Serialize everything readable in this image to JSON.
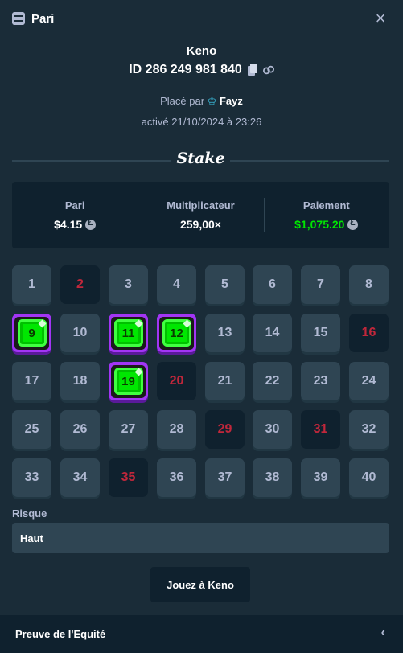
{
  "header": {
    "title": "Pari",
    "icon": "bet-slip-icon",
    "close_icon": "close-icon"
  },
  "bet": {
    "game": "Keno",
    "id": "ID 286 249 981 840",
    "placed_prefix": "Placé par",
    "user": "Fayz",
    "activated": "activé 21/10/2024 à 23:26"
  },
  "brand": "Stake",
  "summary": {
    "bet_label": "Pari",
    "bet_value": "$4.15",
    "multiplier_label": "Multiplicateur",
    "multiplier_value": "259,00×",
    "payout_label": "Paiement",
    "payout_value": "$1,075.20",
    "payout_color": "#00e701"
  },
  "grid": {
    "tiles": [
      {
        "n": "1",
        "s": "normal"
      },
      {
        "n": "2",
        "s": "miss"
      },
      {
        "n": "3",
        "s": "normal"
      },
      {
        "n": "4",
        "s": "normal"
      },
      {
        "n": "5",
        "s": "normal"
      },
      {
        "n": "6",
        "s": "normal"
      },
      {
        "n": "7",
        "s": "normal"
      },
      {
        "n": "8",
        "s": "normal"
      },
      {
        "n": "9",
        "s": "hit"
      },
      {
        "n": "10",
        "s": "normal"
      },
      {
        "n": "11",
        "s": "hit"
      },
      {
        "n": "12",
        "s": "hit"
      },
      {
        "n": "13",
        "s": "normal"
      },
      {
        "n": "14",
        "s": "normal"
      },
      {
        "n": "15",
        "s": "normal"
      },
      {
        "n": "16",
        "s": "miss"
      },
      {
        "n": "17",
        "s": "normal"
      },
      {
        "n": "18",
        "s": "normal"
      },
      {
        "n": "19",
        "s": "hit"
      },
      {
        "n": "20",
        "s": "miss"
      },
      {
        "n": "21",
        "s": "normal"
      },
      {
        "n": "22",
        "s": "normal"
      },
      {
        "n": "23",
        "s": "normal"
      },
      {
        "n": "24",
        "s": "normal"
      },
      {
        "n": "25",
        "s": "normal"
      },
      {
        "n": "26",
        "s": "normal"
      },
      {
        "n": "27",
        "s": "normal"
      },
      {
        "n": "28",
        "s": "normal"
      },
      {
        "n": "29",
        "s": "miss"
      },
      {
        "n": "30",
        "s": "normal"
      },
      {
        "n": "31",
        "s": "miss"
      },
      {
        "n": "32",
        "s": "normal"
      },
      {
        "n": "33",
        "s": "normal"
      },
      {
        "n": "34",
        "s": "normal"
      },
      {
        "n": "35",
        "s": "miss"
      },
      {
        "n": "36",
        "s": "normal"
      },
      {
        "n": "37",
        "s": "normal"
      },
      {
        "n": "38",
        "s": "normal"
      },
      {
        "n": "39",
        "s": "normal"
      },
      {
        "n": "40",
        "s": "normal"
      }
    ]
  },
  "risk": {
    "label": "Risque",
    "value": "Haut"
  },
  "play_button": "Jouez à Keno",
  "footer": {
    "label": "Preuve de l'Equité",
    "chevron_icon": "chevron-left-icon"
  }
}
